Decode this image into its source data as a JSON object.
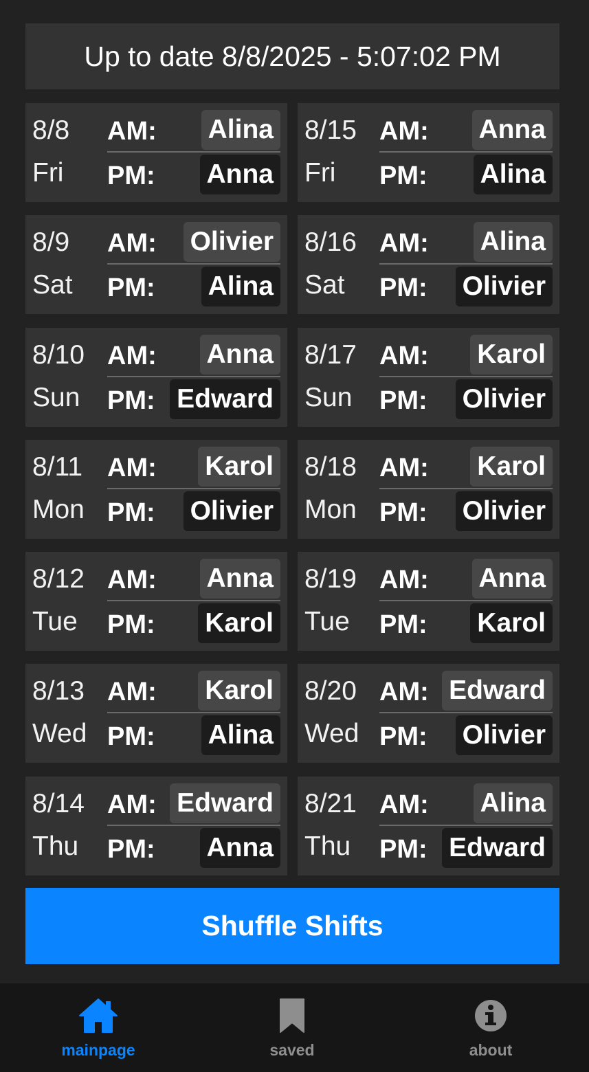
{
  "header": {
    "status_text": "Up to date 8/8/2025 - 5:07:02 PM"
  },
  "labels": {
    "am": "AM:",
    "pm": "PM:"
  },
  "schedule": [
    {
      "date": "8/8",
      "day": "Fri",
      "am": "Alina",
      "pm": "Anna"
    },
    {
      "date": "8/15",
      "day": "Fri",
      "am": "Anna",
      "pm": "Alina"
    },
    {
      "date": "8/9",
      "day": "Sat",
      "am": "Olivier",
      "pm": "Alina"
    },
    {
      "date": "8/16",
      "day": "Sat",
      "am": "Alina",
      "pm": "Olivier"
    },
    {
      "date": "8/10",
      "day": "Sun",
      "am": "Anna",
      "pm": "Edward"
    },
    {
      "date": "8/17",
      "day": "Sun",
      "am": "Karol",
      "pm": "Olivier"
    },
    {
      "date": "8/11",
      "day": "Mon",
      "am": "Karol",
      "pm": "Olivier"
    },
    {
      "date": "8/18",
      "day": "Mon",
      "am": "Karol",
      "pm": "Olivier"
    },
    {
      "date": "8/12",
      "day": "Tue",
      "am": "Anna",
      "pm": "Karol"
    },
    {
      "date": "8/19",
      "day": "Tue",
      "am": "Anna",
      "pm": "Karol"
    },
    {
      "date": "8/13",
      "day": "Wed",
      "am": "Karol",
      "pm": "Alina"
    },
    {
      "date": "8/20",
      "day": "Wed",
      "am": "Edward",
      "pm": "Olivier"
    },
    {
      "date": "8/14",
      "day": "Thu",
      "am": "Edward",
      "pm": "Anna"
    },
    {
      "date": "8/21",
      "day": "Thu",
      "am": "Alina",
      "pm": "Edward"
    }
  ],
  "actions": {
    "shuffle_label": "Shuffle Shifts"
  },
  "tabbar": {
    "tabs": [
      {
        "label": "mainpage",
        "icon": "home-icon",
        "active": true
      },
      {
        "label": "saved",
        "icon": "bookmark-icon",
        "active": false
      },
      {
        "label": "about",
        "icon": "info-icon",
        "active": false
      }
    ]
  },
  "colors": {
    "background": "#222222",
    "card": "#333333",
    "accent": "#0a84ff",
    "am_pill": "#474747",
    "pm_pill": "#1c1c1c",
    "tabbar": "#161616",
    "inactive_tab": "#8e8e8e"
  }
}
